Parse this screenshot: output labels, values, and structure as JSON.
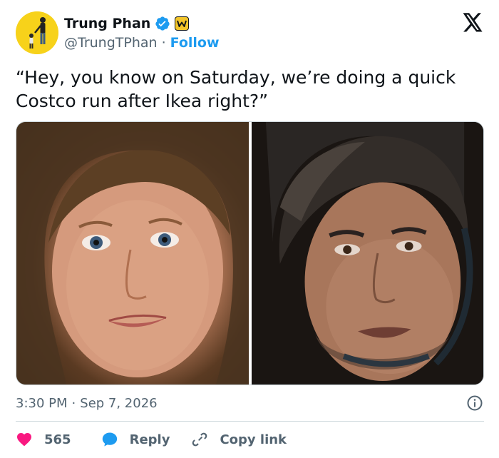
{
  "author": {
    "name": "Trung Phan",
    "handle": "@TrungTPhan",
    "separator": "·",
    "follow_label": "Follow",
    "avatar_icon": "avatar-image",
    "verified_icon": "verified-badge-icon",
    "newsletter_icon": "newsletter-badge-icon",
    "newsletter_letter": "W"
  },
  "brand": {
    "logo_icon": "x-logo-icon"
  },
  "tweet": {
    "text": "“Hey, you know on Saturday, we’re doing a quick Costco run after Ikea right?”"
  },
  "media": {
    "images": [
      {
        "name": "photo-woman",
        "description_icon": "photo"
      },
      {
        "name": "photo-man",
        "description_icon": "photo"
      }
    ]
  },
  "meta": {
    "time": "3:30 PM",
    "separator": "·",
    "date": "Sep 7, 2026",
    "info_icon": "info-icon"
  },
  "actions": {
    "like_count": "565",
    "reply_label": "Reply",
    "copy_link_label": "Copy link"
  },
  "colors": {
    "accent": "#1d9bf0",
    "like": "#f91880",
    "text": "#0f1419",
    "muted": "#536471",
    "border": "#cfd9de",
    "avatar_bg": "#f7d21a"
  }
}
